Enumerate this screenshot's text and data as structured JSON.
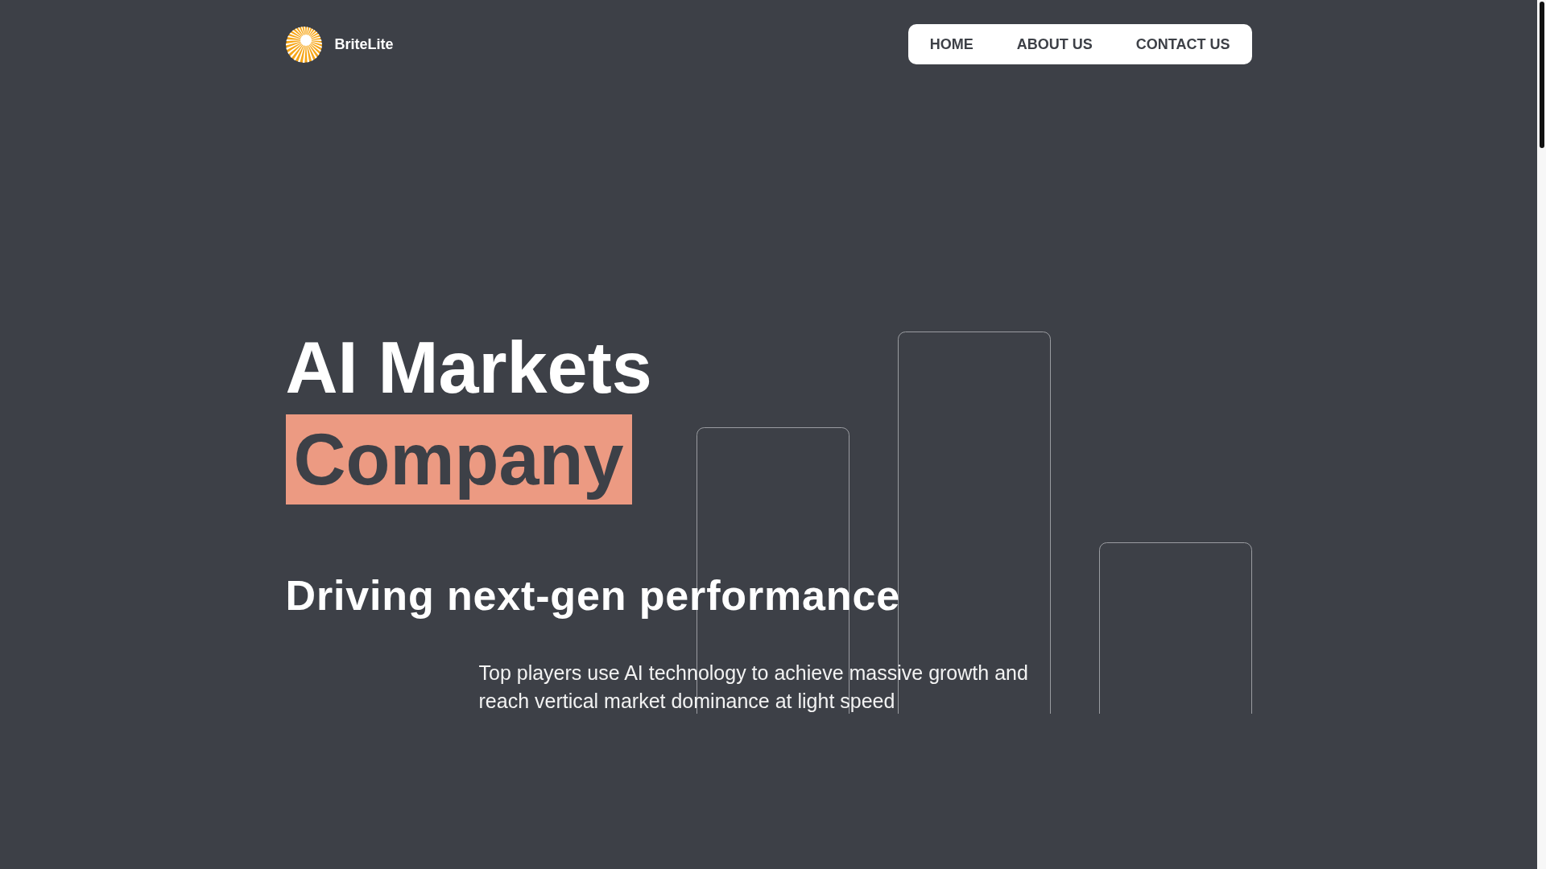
{
  "header": {
    "logo": {
      "name": "BriteLite"
    },
    "nav": [
      {
        "label": "HOME"
      },
      {
        "label": "ABOUT US"
      },
      {
        "label": "CONTACT US"
      }
    ]
  },
  "hero": {
    "title": "AI Markets",
    "highlight": "Company",
    "subtitle": "Driving next-gen performance",
    "description": "Top players use AI technology to achieve massive growth and reach vertical market dominance at light speed"
  }
}
